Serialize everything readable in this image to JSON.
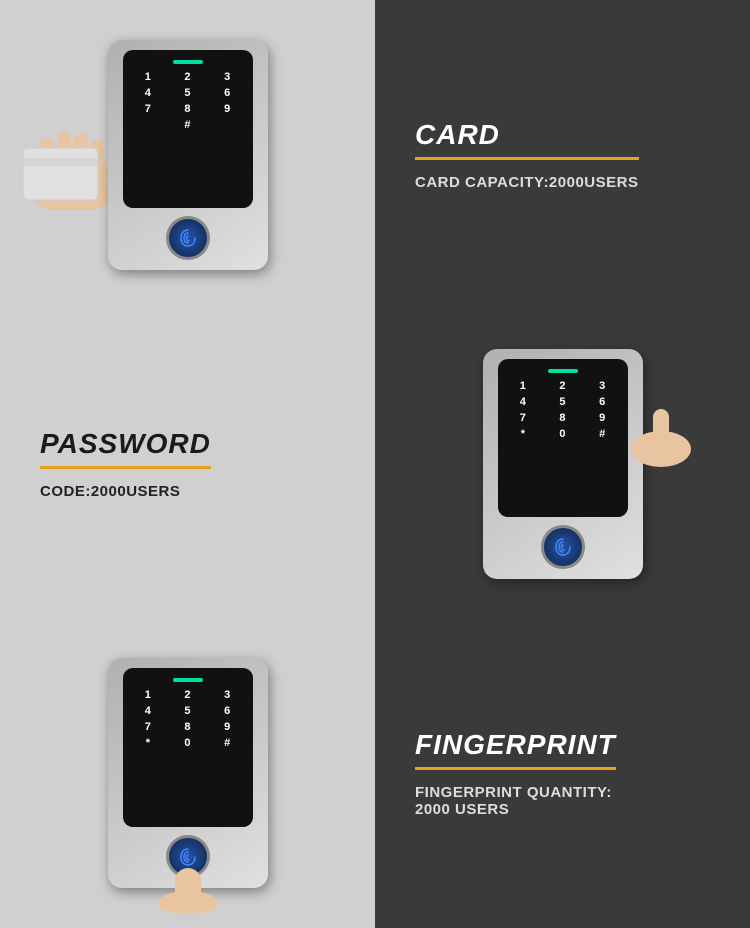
{
  "cells": {
    "card_title": "CARD",
    "card_desc": "CARD CAPACITY:2000USERS",
    "password_title": "PASSWORD",
    "password_desc": "CODE:2000USERS",
    "fingerprint_title": "FINGERPRINT",
    "fingerprint_desc": "FINGERPRINT QUANTITY:\n2000 USERS"
  },
  "keypad": {
    "indicator_color": "#00e0a0",
    "keys": [
      "1",
      "2",
      "3",
      "4",
      "5",
      "6",
      "7",
      "8",
      "9",
      "*",
      "0",
      "#"
    ]
  },
  "colors": {
    "dark_bg": "#3a3a3a",
    "light_bg": "#d0d0d0",
    "accent": "#e8a020",
    "white": "#ffffff",
    "dark_text": "#1a1a1a"
  }
}
